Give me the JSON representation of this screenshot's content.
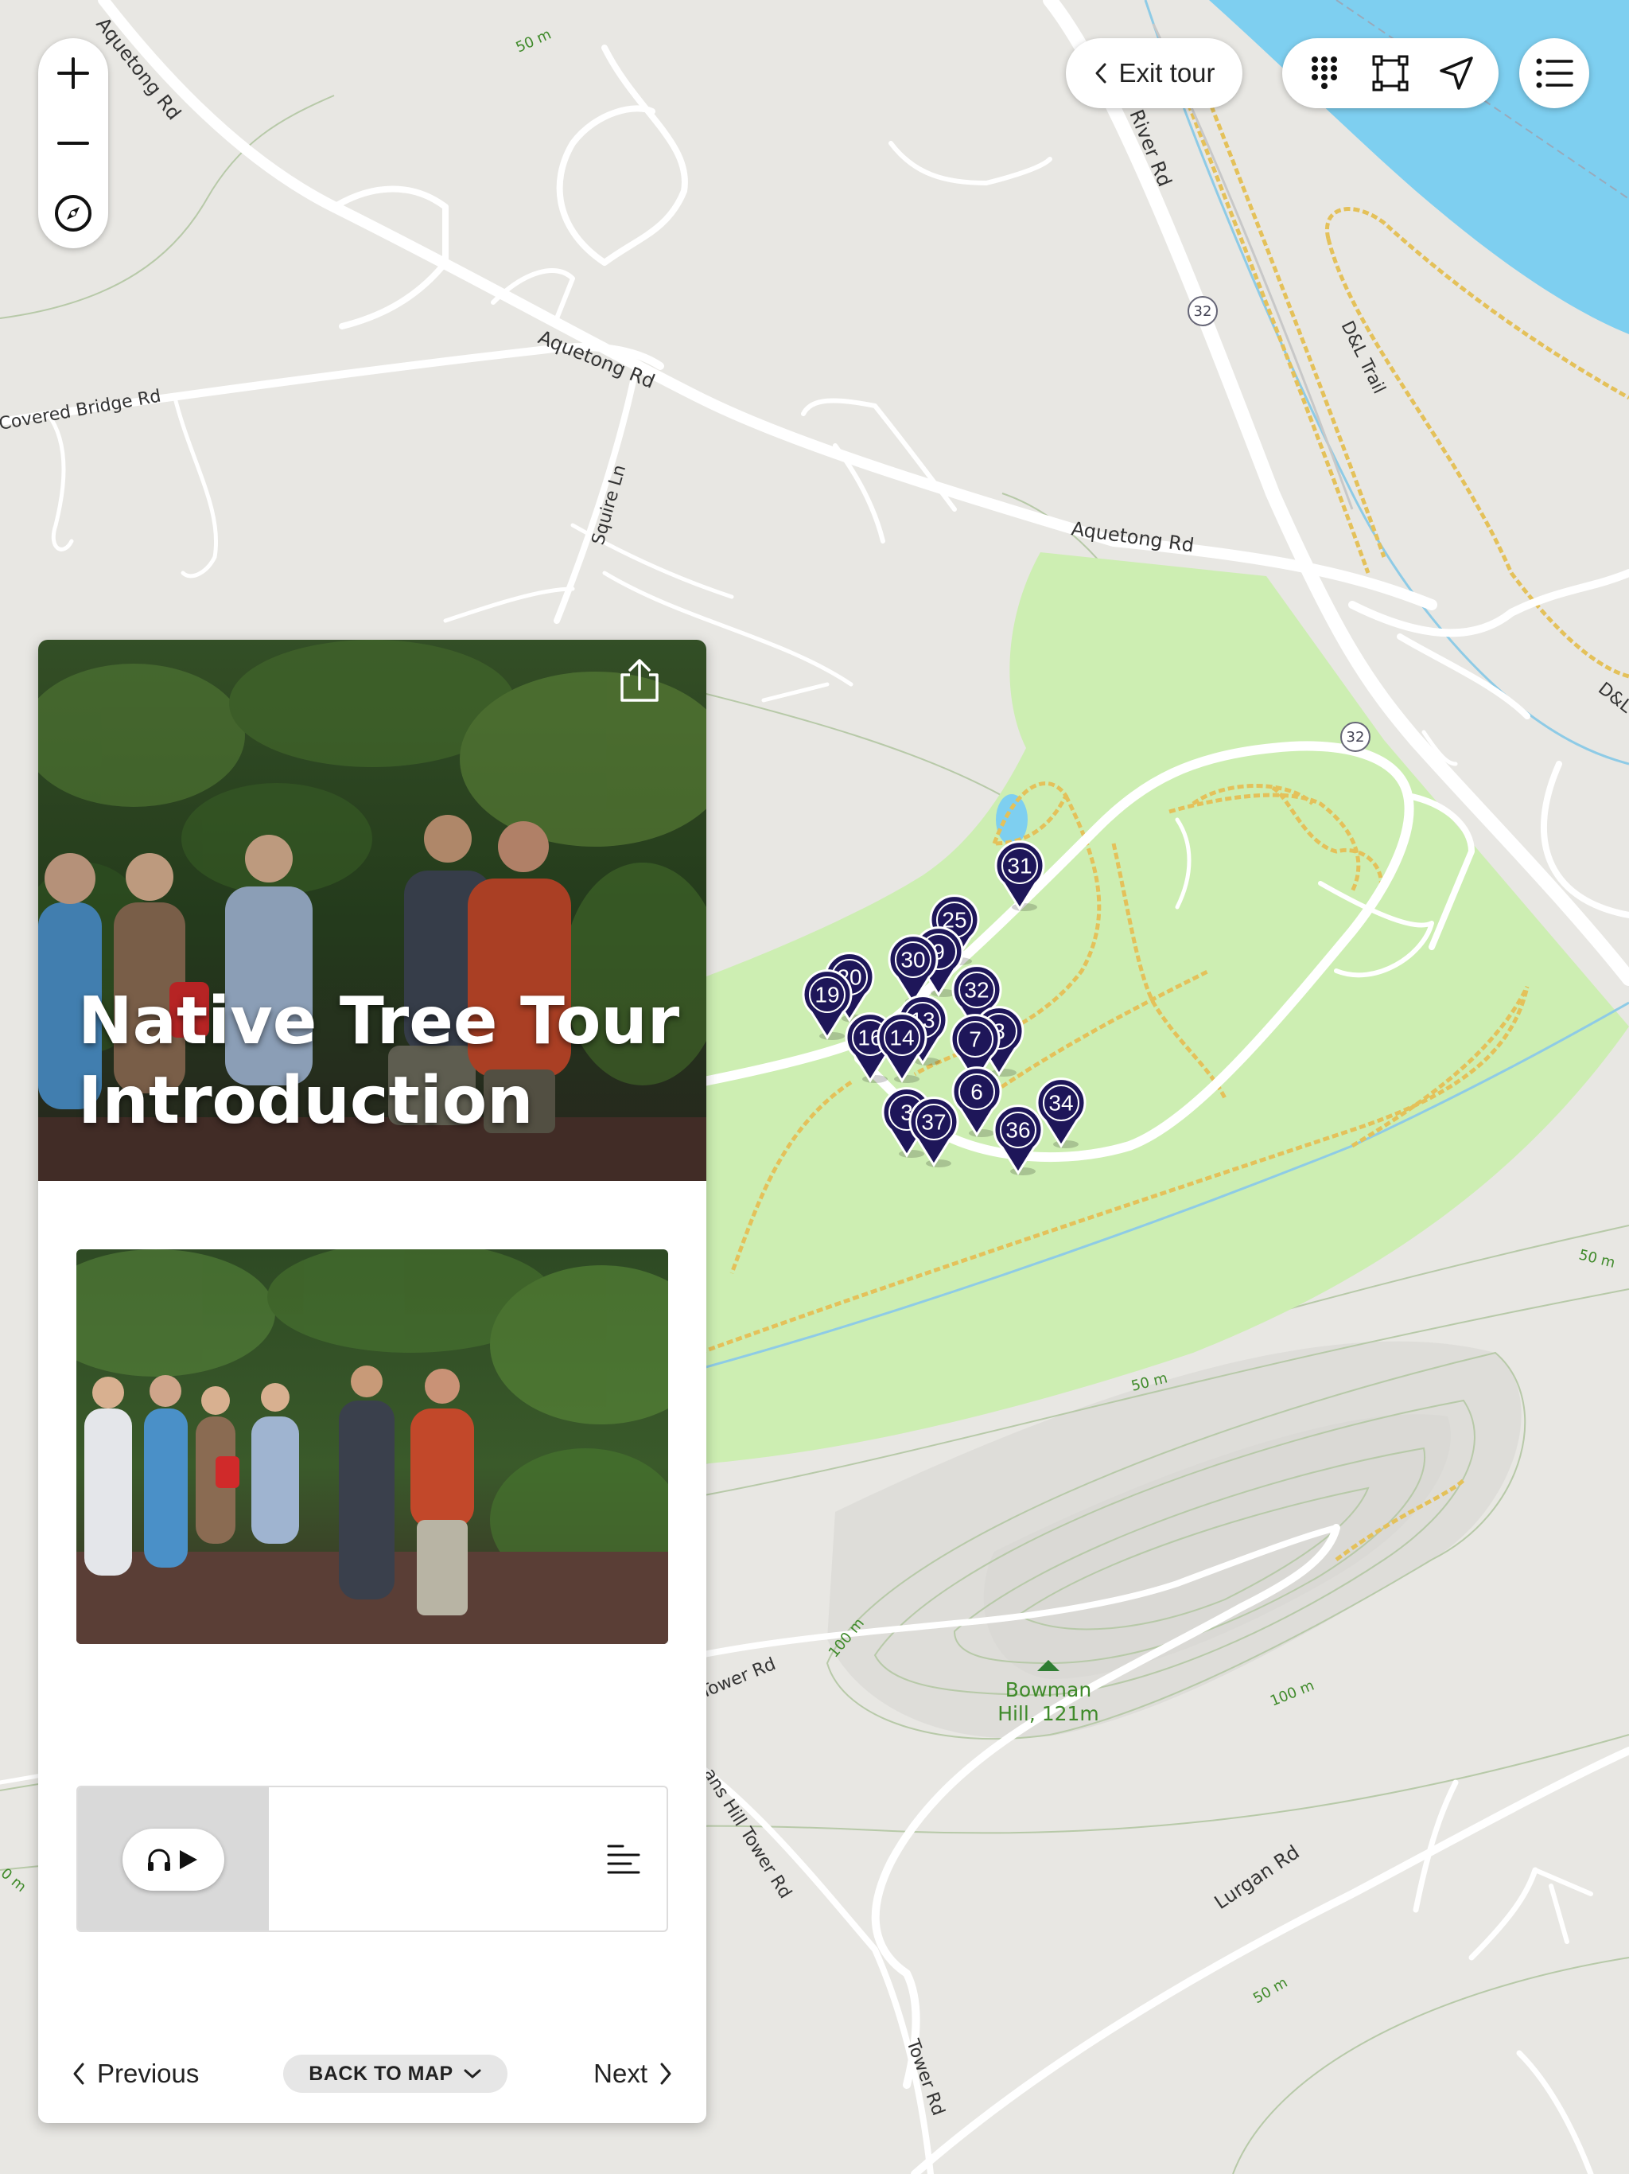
{
  "map": {
    "road_labels": {
      "aquetong_top": "Aquetong Rd",
      "aquetong_mid": "Aquetong Rd",
      "aquetong_right": "Aquetong Rd",
      "covered_bridge": "Covered Bridge Rd",
      "squire": "Squire Ln",
      "river": "River Rd",
      "dl_trail": "D&L Trail",
      "dl_right": "D&L",
      "tower_left": "Tower Rd",
      "bowman_hill_tower": "ans Hill Tower Rd",
      "tower_bottom": "Tower Rd",
      "lurgan": "Lurgan Rd"
    },
    "route_shields": [
      "32",
      "32"
    ],
    "contour_labels": [
      "50 m",
      "50 m",
      "50 m",
      "100 m",
      "100 m",
      "50 m",
      "0 m"
    ],
    "peak": {
      "name": "Bowman",
      "elevation": "Hill, 121m"
    },
    "colors": {
      "land": "#e8e7e3",
      "park": "#cdeeb2",
      "water": "#7ecff0",
      "marker": "#1e1659",
      "trail": "#e4c15a"
    }
  },
  "tour_stops": [
    {
      "label": "31"
    },
    {
      "label": "25"
    },
    {
      "label": "9"
    },
    {
      "label": "30"
    },
    {
      "label": "20"
    },
    {
      "label": "19"
    },
    {
      "label": "32"
    },
    {
      "label": "13"
    },
    {
      "label": "16"
    },
    {
      "label": "14"
    },
    {
      "label": "3"
    },
    {
      "label": "7"
    },
    {
      "label": "6"
    },
    {
      "label": "34"
    },
    {
      "label": "3"
    },
    {
      "label": "37"
    },
    {
      "label": "36"
    }
  ],
  "controls": {
    "zoom_in": "zoom-in-icon",
    "zoom_out": "zoom-out-icon",
    "compass": "compass-icon",
    "exit_tour": "Exit tour",
    "tools": [
      "dots-grid-icon",
      "bounding-box-icon",
      "location-arrow-icon"
    ],
    "list": "list-icon"
  },
  "panel": {
    "title_line1": "Native Tree Tour",
    "title_line2": "Introduction",
    "share_icon": "share-icon",
    "audio": {
      "play_icon": "headphones-play-icon",
      "transcript_icon": "transcript-icon"
    },
    "footer": {
      "previous": "Previous",
      "back_to_map": "BACK TO MAP",
      "next": "Next"
    }
  }
}
